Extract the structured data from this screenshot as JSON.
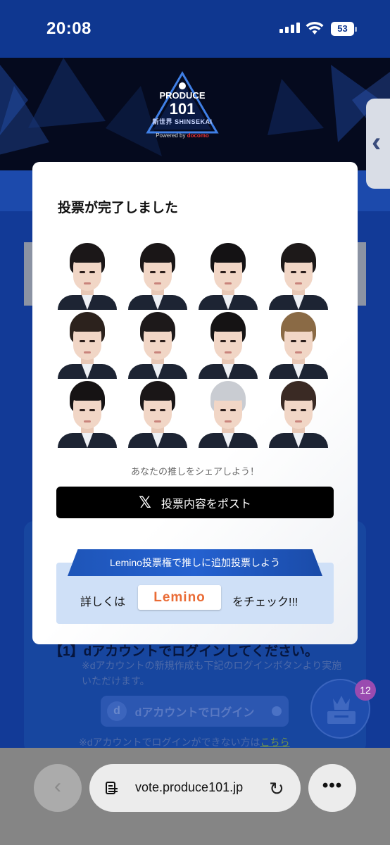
{
  "status_bar": {
    "time": "20:08",
    "battery": "53"
  },
  "hero": {
    "logo_top": "PRODUCE",
    "logo_number": "101",
    "logo_subtitle": "新世界 SHINSEKAI",
    "sponsor_prefix": "Powered by",
    "sponsor": "docomo"
  },
  "background": {
    "side_tab_glyph": "‹",
    "login_step": "【1】dアカウントでログインしてください。",
    "login_note": "※dアカウントの新規作成も下記のログインボタンより実施いただけます。",
    "login_button": "dアカウントでログイン",
    "login_help_prefix": "※dアカウントでログインができない方は",
    "login_help_link": "こちら",
    "vote_badge": "12"
  },
  "modal": {
    "title": "投票が完了しました",
    "trainees": [
      {
        "hair": "#1b1718"
      },
      {
        "hair": "#1a1617"
      },
      {
        "hair": "#141214"
      },
      {
        "hair": "#1d1919"
      },
      {
        "hair": "#2c221d"
      },
      {
        "hair": "#1d191a"
      },
      {
        "hair": "#151314"
      },
      {
        "hair": "#8a6a45"
      },
      {
        "hair": "#161314"
      },
      {
        "hair": "#1a1617"
      },
      {
        "hair": "#c9ccd2"
      },
      {
        "hair": "#3a2a24"
      }
    ],
    "share_text": "あなたの推しをシェアしよう！",
    "post_button": "投票内容をポスト",
    "x_glyph": "𝕏",
    "lemino_banner": "Lemino投票権で推しに追加投票しよう",
    "lemino_pre": "詳しくは",
    "lemino_logo": "Lemino",
    "lemino_post": "をチェック!!!"
  },
  "browser": {
    "back_glyph": "‹",
    "url": "vote.produce101.jp",
    "reload_glyph": "↻",
    "more_glyph": "•••"
  },
  "colors": {
    "status_bar": "#0f3790",
    "page": "#123a97",
    "post_button": "#000000",
    "lemino_banner": "#1e55b8",
    "lemino_logo": "#ea6b35"
  }
}
